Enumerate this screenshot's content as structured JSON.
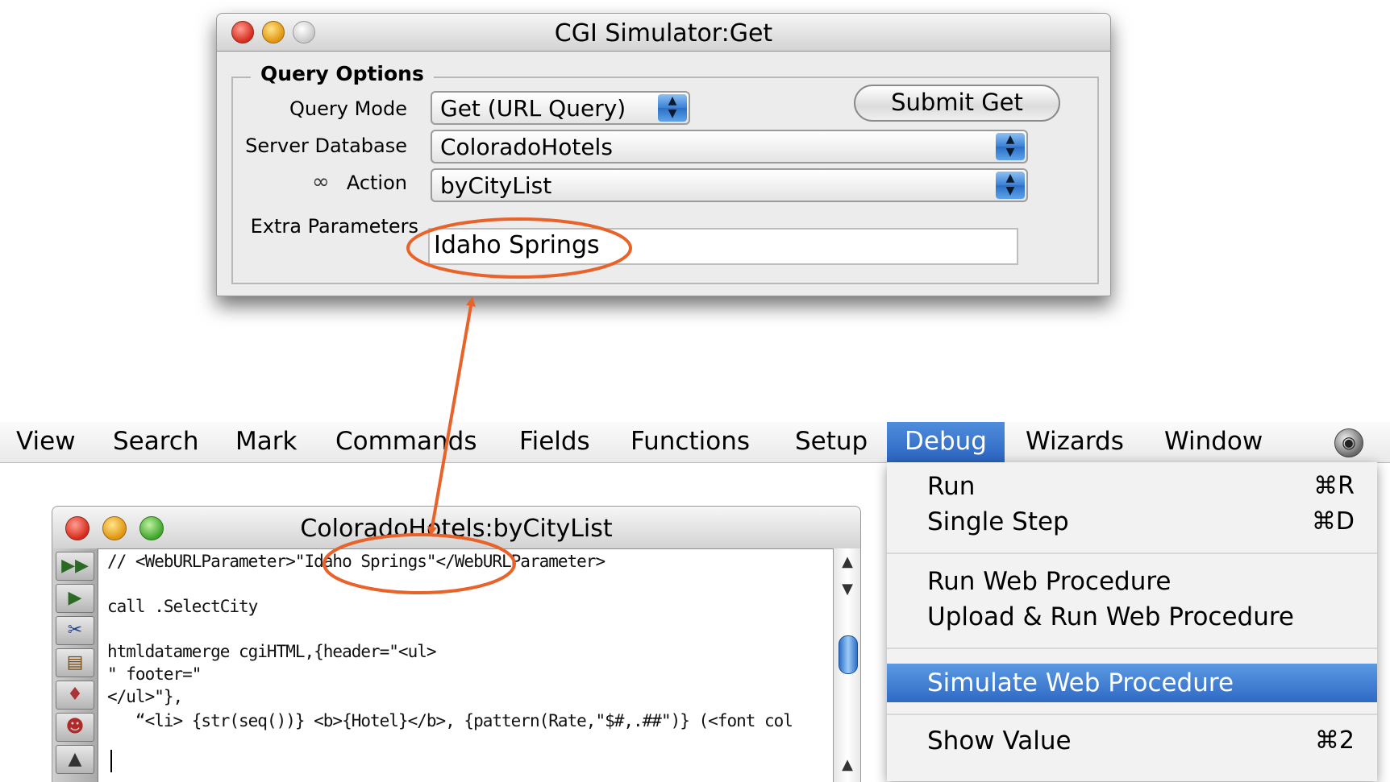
{
  "cgi_window": {
    "title": "CGI Simulator:Get",
    "group_title": "Query Options",
    "query_mode": {
      "label": "Query Mode",
      "value": "Get (URL Query)"
    },
    "submit_label": "Submit Get",
    "server_database": {
      "label": "Server Database",
      "value": "ColoradoHotels"
    },
    "action": {
      "label": "Action",
      "icon": "link-chain-icon",
      "value": "byCityList"
    },
    "extra_parameters": {
      "label": "Extra Parameters",
      "value": "Idaho Springs"
    }
  },
  "menubar": {
    "items": [
      "View",
      "Search",
      "Mark",
      "Commands",
      "Fields",
      "Functions",
      "Setup",
      "Debug",
      "Wizards",
      "Window"
    ],
    "active": "Debug",
    "right_icon": "globe-icon"
  },
  "debug_menu": {
    "items": [
      {
        "label": "Run",
        "shortcut": "⌘R"
      },
      {
        "label": "Single Step",
        "shortcut": "⌘D"
      },
      {
        "label": "Run Web Procedure",
        "shortcut": ""
      },
      {
        "label": "Upload & Run Web Procedure",
        "shortcut": ""
      },
      {
        "label": "Simulate Web Procedure",
        "shortcut": "",
        "highlighted": true
      },
      {
        "label": "Show Value",
        "shortcut": "⌘2"
      }
    ]
  },
  "procedure_window": {
    "title": "ColoradoHotels:byCityList",
    "code_lines": [
      "// <WebURLParameter>\"Idaho Springs\"</WebURLParameter>",
      "",
      "call .SelectCity",
      "",
      "htmldatamerge cgiHTML,{header=\"<ul>",
      "\" footer=\"",
      "</ul>\"},",
      "   “<li> {str(seq())} <b>{Hotel}</b>, {pattern(Rate,\"$#,.##\")} (<font col"
    ],
    "toolbar_icons": [
      "run-all-icon",
      "step-icon",
      "scissors-icon",
      "notebook-icon",
      "bell-icon",
      "people-icon",
      "triangle-icon"
    ]
  },
  "annotation": {
    "color": "#e8622a"
  }
}
